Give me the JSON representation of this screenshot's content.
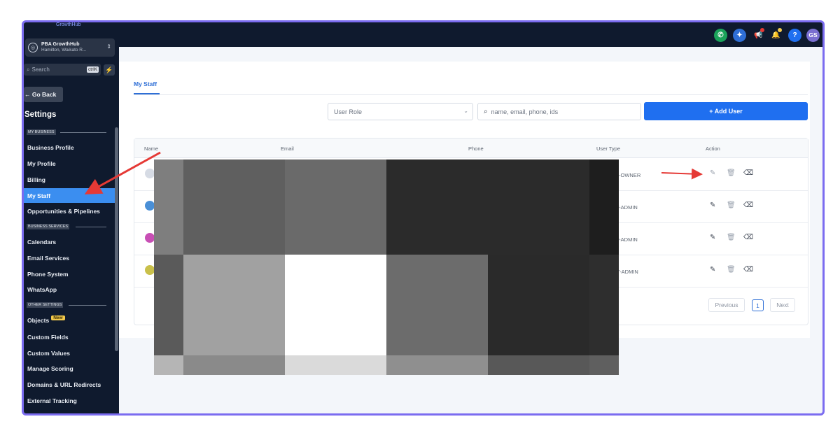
{
  "sidebar": {
    "logo_text": "GrowthHub",
    "location": {
      "name": "PBA GrowthHub",
      "sub": "Hamilton, Waikato R..."
    },
    "search": {
      "placeholder": "Search",
      "shortcut": "ctrlK"
    },
    "go_back": "← Go Back",
    "title": "Settings",
    "sections": [
      {
        "label": "MY BUSINESS",
        "items": [
          "Business Profile",
          "My Profile",
          "Billing",
          "My Staff",
          "Opportunities & Pipelines"
        ]
      },
      {
        "label": "BUSINESS SERVICES",
        "items": [
          "Calendars",
          "Email Services",
          "Phone System",
          "WhatsApp"
        ]
      },
      {
        "label": "OTHER SETTINGS",
        "items": [
          "Objects",
          "Custom Fields",
          "Custom Values",
          "Manage Scoring",
          "Domains & URL Redirects",
          "External Tracking"
        ]
      }
    ],
    "active_item": "My Staff",
    "new_badge": "New"
  },
  "topbar": {
    "avatar_initials": "GS",
    "help": "?"
  },
  "content": {
    "tab": "My Staff",
    "role_placeholder": "User Role",
    "search_placeholder": "name, email, phone, ids",
    "add_user": "+ Add User",
    "columns": {
      "name": "Name",
      "email": "Email",
      "phone": "Phone",
      "user_type": "User Type",
      "action": "Action"
    },
    "rows": [
      {
        "user_type": "-OWNER"
      },
      {
        "user_type": "T-ADMIN"
      },
      {
        "user_type": "T-ADMIN"
      },
      {
        "user_type": "ST-ADMIN"
      }
    ],
    "pagination": {
      "previous": "Previous",
      "page": "1",
      "next": "Next"
    }
  },
  "colors": {
    "accent": "#1f6ff0",
    "sidebar_bg": "#0f1a2e",
    "active_nav": "#3b8ef0",
    "frame": "#7b6cf0",
    "arrow": "#e53935"
  }
}
